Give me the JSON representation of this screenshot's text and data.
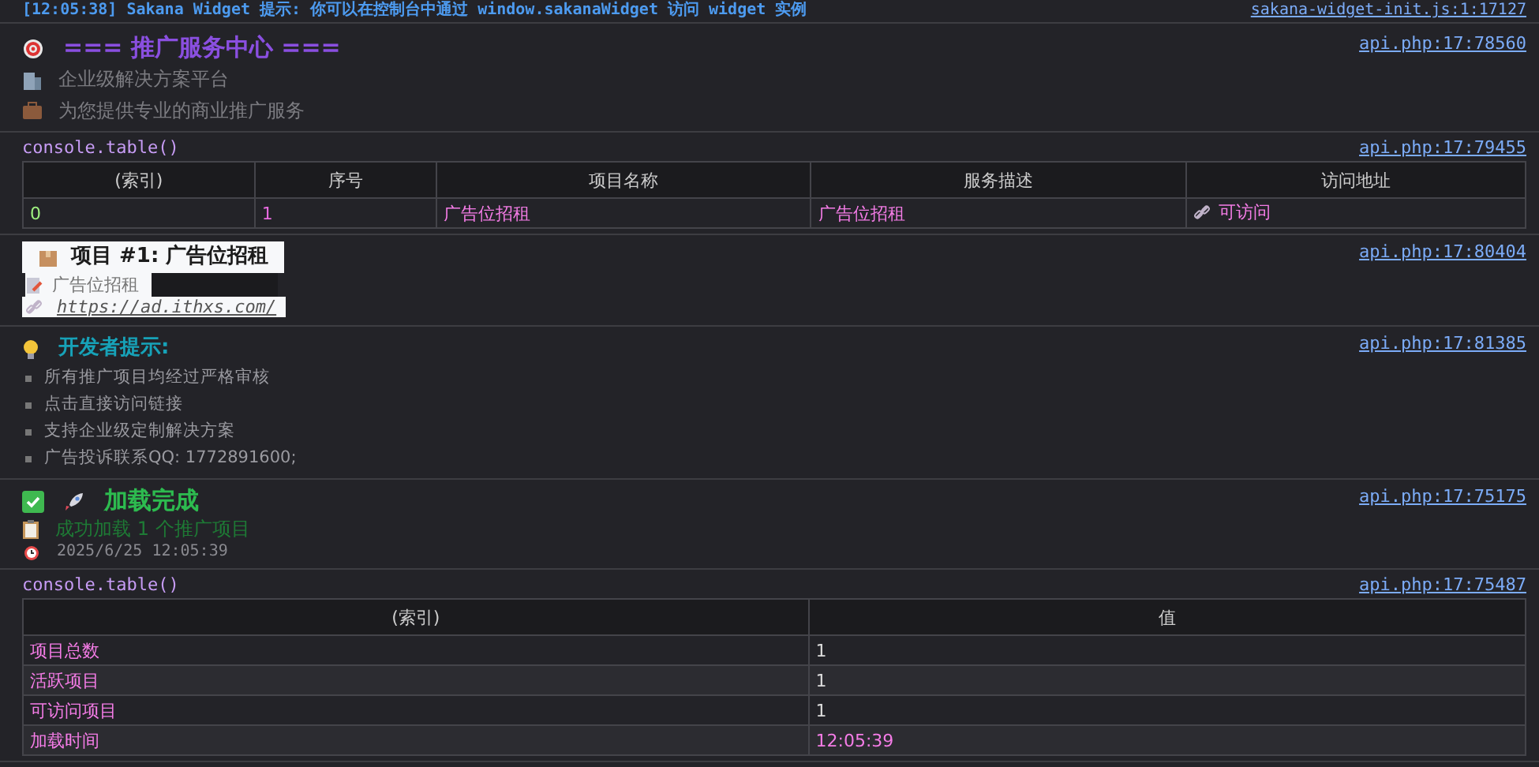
{
  "top_line": {
    "text": "[12:05:38] Sakana Widget 提示: 你可以在控制台中通过 window.sakanaWidget 访问 widget 实例",
    "source": "sakana-widget-init.js:1:17127"
  },
  "entries": [
    {
      "kind": "banner",
      "source": "api.php:17:78560",
      "title": "=== 推广服务中心 ===",
      "lines": [
        "企业级解决方案平台",
        "为您提供专业的商业推广服务"
      ]
    },
    {
      "kind": "table",
      "source": "api.php:17:79455",
      "label": "console.table()",
      "columns": [
        "(索引)",
        "序号",
        "项目名称",
        "服务描述",
        "访问地址"
      ],
      "rows": [
        [
          {
            "text": "0",
            "kind": "index"
          },
          {
            "text": "1",
            "kind": "number"
          },
          {
            "text": "广告位招租",
            "kind": "string"
          },
          {
            "text": "广告位招租",
            "kind": "string"
          },
          {
            "text": "可访问",
            "kind": "link"
          }
        ]
      ]
    },
    {
      "kind": "card",
      "source": "api.php:17:80404",
      "title": "项目 #1: 广告位招租",
      "description": "广告位招租",
      "url": "https://ad.ithxs.com/"
    },
    {
      "kind": "tips",
      "source": "api.php:17:81385",
      "title": "开发者提示:",
      "items": [
        "所有推广项目均经过严格审核",
        "点击直接访问链接",
        "支持企业级定制解决方案",
        "广告投诉联系QQ: 1772891600;"
      ]
    },
    {
      "kind": "done",
      "source": "api.php:17:75175",
      "title": "加载完成",
      "message": "成功加载 1 个推广项目",
      "time": "2025/6/25 12:05:39"
    },
    {
      "kind": "table",
      "source": "api.php:17:75487",
      "label": "console.table()",
      "columns": [
        "(索引)",
        "值"
      ],
      "rows": [
        [
          {
            "text": "项目总数",
            "kind": "key"
          },
          {
            "text": "1",
            "kind": "plain"
          }
        ],
        [
          {
            "text": "活跃项目",
            "kind": "key"
          },
          {
            "text": "1",
            "kind": "plain"
          }
        ],
        [
          {
            "text": "可访问项目",
            "kind": "key"
          },
          {
            "text": "1",
            "kind": "plain"
          }
        ],
        [
          {
            "text": "加载时间",
            "kind": "key"
          },
          {
            "text": "12:05:39",
            "kind": "string"
          }
        ]
      ]
    }
  ]
}
